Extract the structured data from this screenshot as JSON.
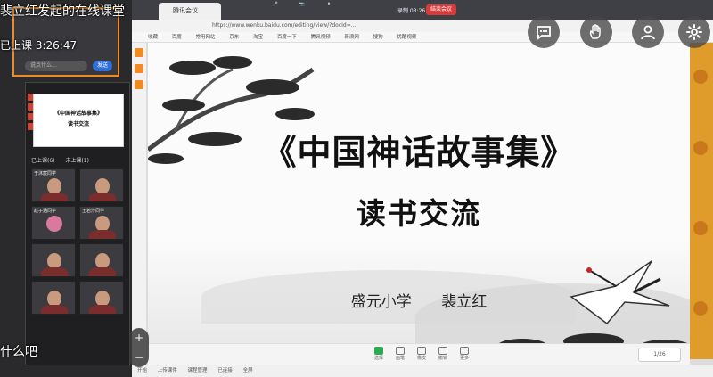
{
  "overlay": {
    "class_title": "裴立红发起的在线课堂",
    "timer_label": "已上课",
    "timer": "3:26:47",
    "chat_snippet": "什么吧",
    "buttons": [
      "chat-icon",
      "raise-hand-icon",
      "person-icon",
      "gear-icon"
    ]
  },
  "left_panel": {
    "message_placeholder": "说点什么...",
    "send_label": "发送",
    "thumb_title": "《中国神话故事集》",
    "thumb_sub": "读书交流",
    "tab_joined": "已上课(6)",
    "tab_not_joined": "未上课(1)",
    "participants": [
      "于沐宸同学",
      "",
      "赵子涵同学",
      "王若汐同学",
      "",
      "",
      "",
      ""
    ]
  },
  "browser": {
    "tab_label": "腾讯会议",
    "url": "https://www.wenku.baidu.com/editing/view/?docId=...",
    "bookmarks": [
      "收藏",
      "百度",
      "常用网站",
      "京东",
      "淘宝",
      "百度一下",
      "腾讯视频",
      "新浪网",
      "搜狗",
      "优酷视频"
    ],
    "recording": "录制 03:26:40",
    "end_button": "结束会议"
  },
  "slide": {
    "title": "《中国神话故事集》",
    "subtitle": "读书交流",
    "school": "盛元小学",
    "teacher": "裴立红"
  },
  "toolbar": {
    "tools": [
      "选择",
      "画笔",
      "橡皮",
      "撤销",
      "更多"
    ],
    "page": "1/26"
  },
  "taskbar": {
    "items": [
      "开始",
      "上传课件",
      "课程管理",
      "已连接",
      "全屏"
    ]
  }
}
